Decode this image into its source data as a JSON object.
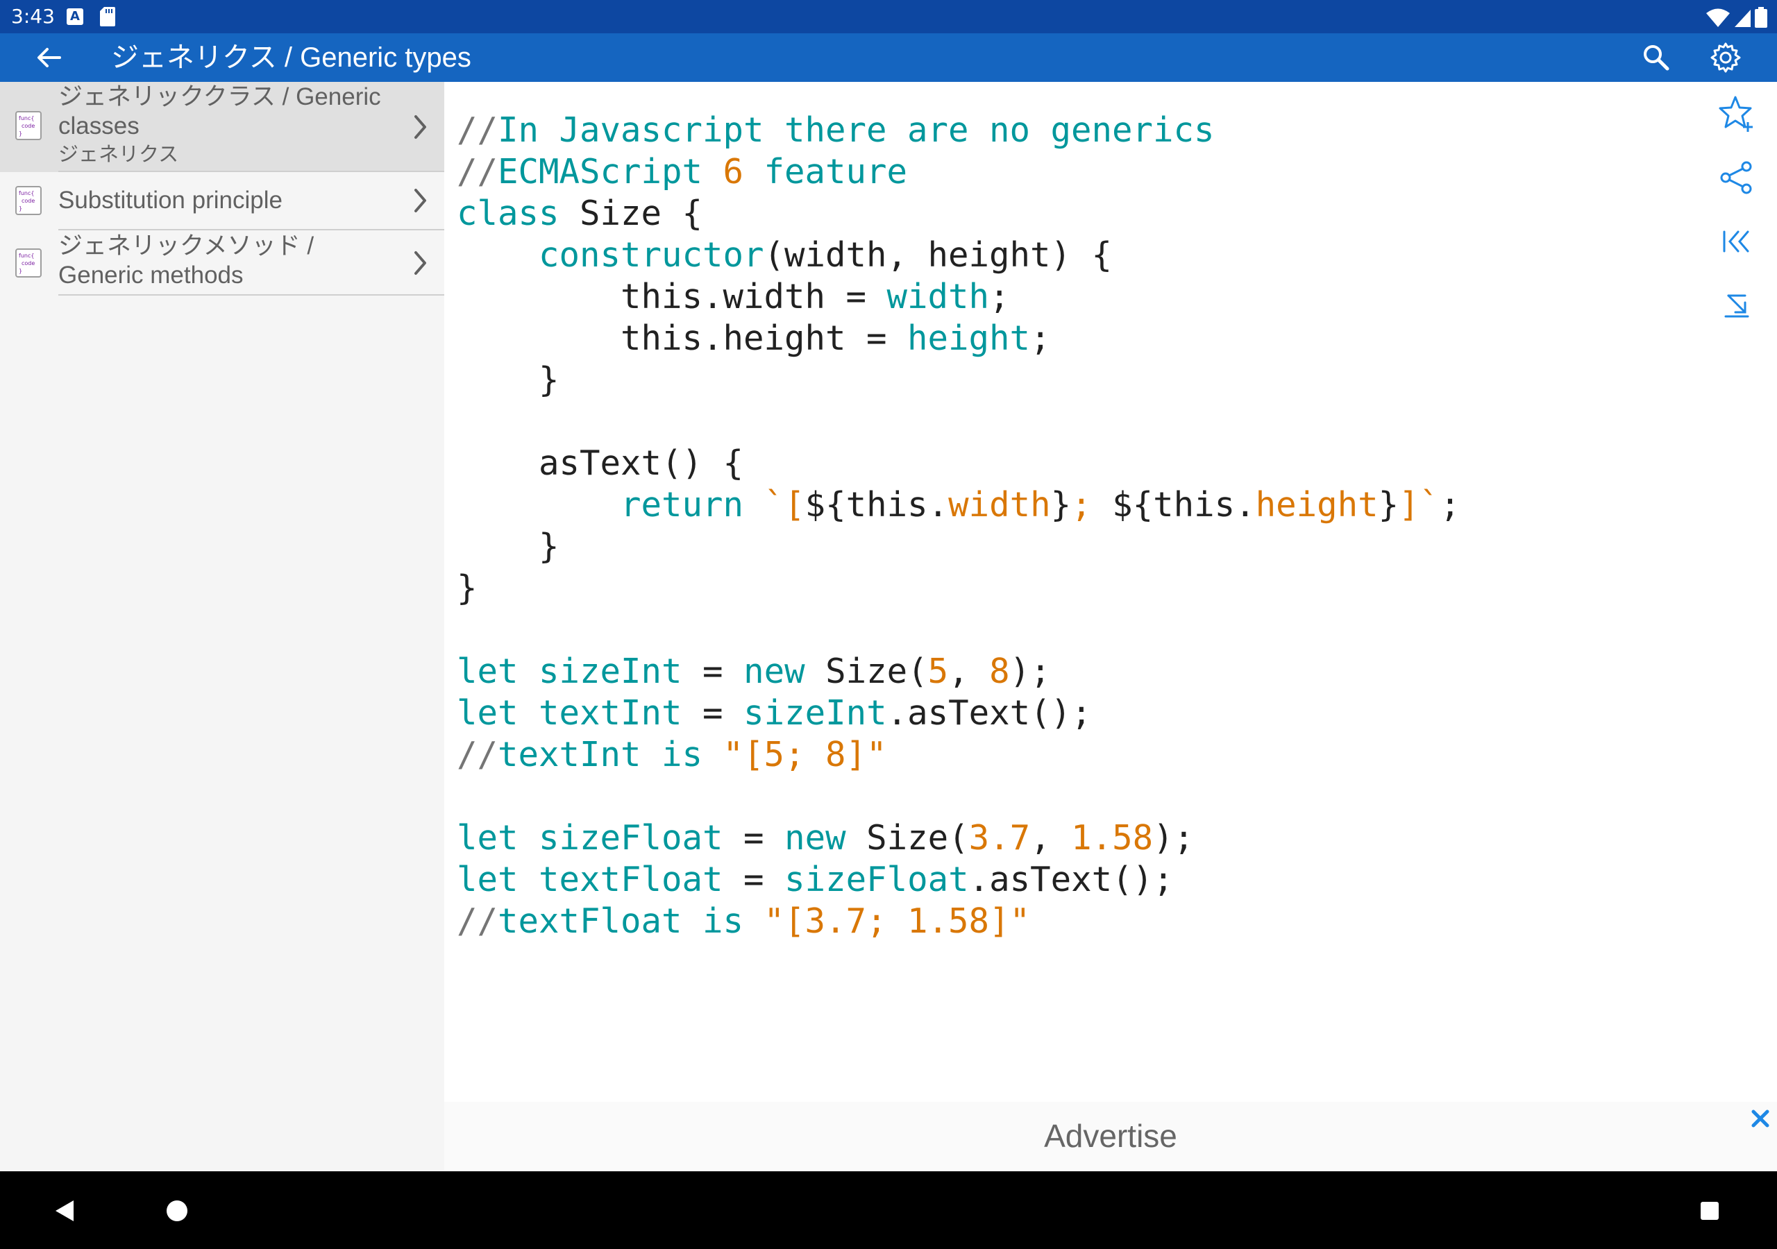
{
  "status": {
    "time": "3:43",
    "a_badge": "A"
  },
  "appbar": {
    "title": "ジェネリクス / Generic types"
  },
  "sidebar": {
    "items": [
      {
        "title": "ジェネリッククラス / Generic classes",
        "subtitle": "ジェネリクス",
        "selected": true
      },
      {
        "title": "Substitution principle",
        "subtitle": "",
        "selected": false
      },
      {
        "title": "ジェネリックメソッド / Generic methods",
        "subtitle": "",
        "selected": false
      }
    ],
    "item_icon_text": "func{ code }"
  },
  "code": {
    "language": "javascript",
    "lines": [
      "//In Javascript there are no generics",
      "//ECMAScript 6 feature",
      "class Size {",
      "    constructor(width, height) {",
      "        this.width = width;",
      "        this.height = height;",
      "    }",
      "",
      "    asText() {",
      "        return `[${this.width}; ${this.height}]`;",
      "    }",
      "}",
      "",
      "let sizeInt = new Size(5, 8);",
      "let textInt = sizeInt.asText();",
      "//textInt is \"[5; 8]\"",
      "",
      "let sizeFloat = new Size(3.7, 1.58);",
      "let textFloat = sizeFloat.asText();",
      "//textFloat is \"[3.7; 1.58]\""
    ]
  },
  "actions": [
    "favorite-add-icon",
    "share-icon",
    "first-page-icon",
    "last-page-icon"
  ],
  "ad": {
    "label": "Advertise"
  },
  "colors": {
    "status_bar": "#0d47a1",
    "app_bar": "#1565c0",
    "code_keyword": "#00979c",
    "code_literal": "#d97706",
    "accent": "#1e88e5"
  }
}
